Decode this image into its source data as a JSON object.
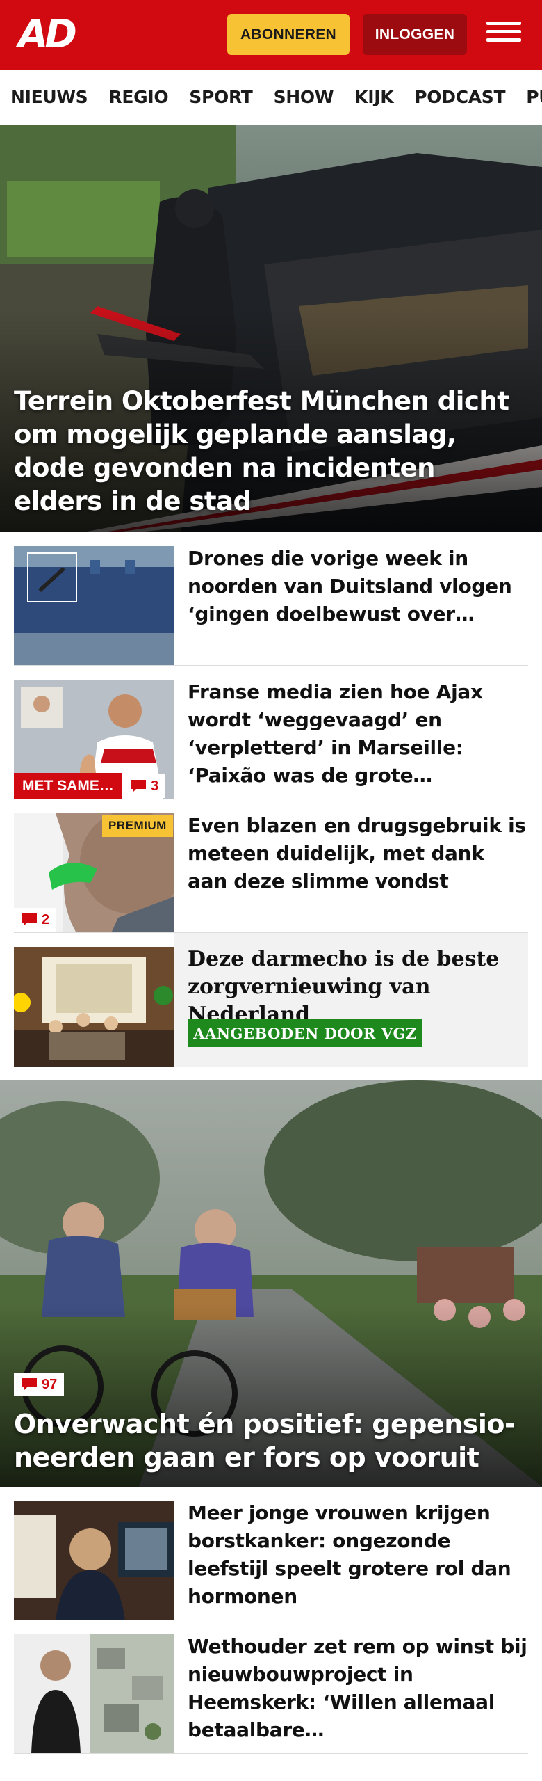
{
  "header": {
    "logo": "AD",
    "subscribe_label": "ABONNEREN",
    "login_label": "INLOGGEN"
  },
  "nav": {
    "items": [
      "NIEUWS",
      "REGIO",
      "SPORT",
      "SHOW",
      "KIJK",
      "PODCAST",
      "PUZZ"
    ]
  },
  "hero": {
    "title": "Terrein Oktoberfest München dicht om mogelijk geplande aanslag, dode gevonden na incidenten elders in de stad"
  },
  "articles": [
    {
      "title": "Drones die vorige week in noorden van Duitsland vlogen ‘gingen doelbewust over…"
    },
    {
      "title": "Franse media zien hoe Ajax wordt ‘weggevaagd’ en ‘verpletterd’ in Marseille: ‘Paixão was de grote…",
      "badge": "MET SAME…",
      "comments": "3"
    },
    {
      "title": "Even blazen en drugsgebruik is meteen duidelijk, met dank aan deze slimme vondst",
      "premium": "PREMIUM",
      "comments": "2"
    }
  ],
  "ad": {
    "title": "Deze darmecho is de beste zorgvernieuwing van Nederland",
    "sponsor": "AANGEBODEN DOOR VGZ"
  },
  "hero2": {
    "comments": "97",
    "title": "Onverwacht én positief: gepensio-neerden gaan er fors op vooruit"
  },
  "articles2": [
    {
      "title": "Meer jonge vrouwen krijgen borstkanker: ongezonde leefstijl speelt grotere rol dan hormonen"
    },
    {
      "title": "Wethouder zet rem op winst bij nieuwbouwproject in Heemskerk: ‘Willen allemaal betaalbare…"
    }
  ],
  "colors": {
    "brand_red": "#d10a11",
    "subscribe_yellow": "#f7c234",
    "login_dark_red": "#9b0b10",
    "ad_green": "#1e8a1e"
  }
}
